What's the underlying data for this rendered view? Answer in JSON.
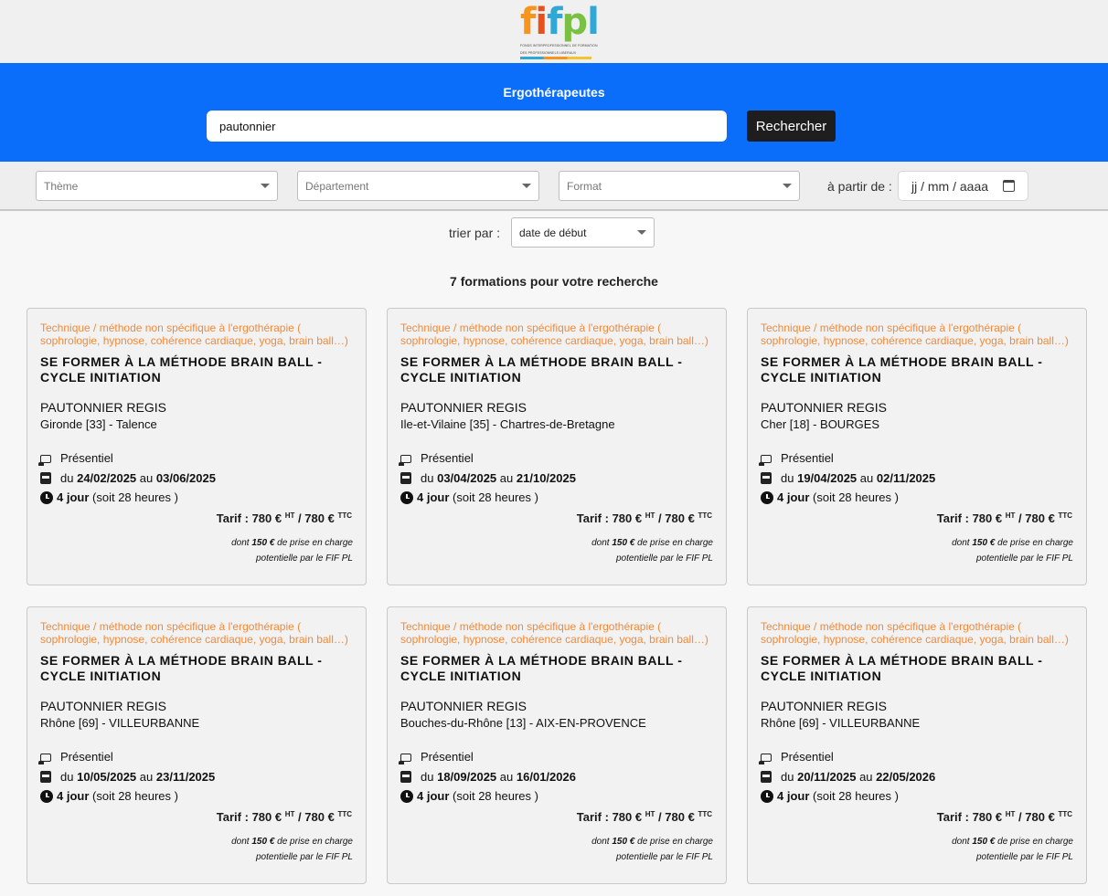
{
  "logo": {
    "name": "fifpl",
    "letters": [
      "f",
      "i",
      "f",
      "p",
      "l"
    ],
    "subtitle_line1": "FONDS INTERPROFESSIONNEL DE FORMATION",
    "subtitle_line2": "DES PROFESSIONNELS LIBERAUX"
  },
  "search": {
    "profession": "Ergothérapeutes",
    "query": "pautonnier",
    "button_label": "Rechercher"
  },
  "filters": {
    "theme_placeholder": "Thème",
    "department_placeholder": "Département",
    "format_placeholder": "Format",
    "date_label": "à partir de :",
    "date_placeholder": "jj / mm / aaaa"
  },
  "sort": {
    "label": "trier par :",
    "selected": "date de début"
  },
  "results": {
    "count_text": "7 formations pour votre recherche"
  },
  "card_labels": {
    "du": "du",
    "au": "au",
    "tarif_prefix": "Tarif :",
    "ht": "HT",
    "ttc": "TTC",
    "note_prefix": "dont",
    "note_suffix": "de prise en charge",
    "note_line2": "potentielle par le FIF PL"
  },
  "cards": [
    {
      "theme": "Technique / méthode non spécifique à l'ergothérapie ( sophrologie, hypnose, cohérence cardiaque, yoga, brain ball…)",
      "title": "SE FORMER À LA MÉTHODE BRAIN BALL - CYCLE INITIATION",
      "organizer": "PAUTONNIER REGIS",
      "location": "Gironde [33] - Talence",
      "format": "Présentiel",
      "date_start": "24/02/2025",
      "date_end": "03/06/2025",
      "duration_bold": "4 jour",
      "duration_rest": "(soit 28 heures )",
      "price_ht": "780 €",
      "price_ttc": "780 €",
      "support_amount": "150 €"
    },
    {
      "theme": "Technique / méthode non spécifique à l'ergothérapie ( sophrologie, hypnose, cohérence cardiaque, yoga, brain ball…)",
      "title": "SE FORMER À LA MÉTHODE BRAIN BALL - CYCLE INITIATION",
      "organizer": "PAUTONNIER REGIS",
      "location": "Ile-et-Vilaine [35] - Chartres-de-Bretagne",
      "format": "Présentiel",
      "date_start": "03/04/2025",
      "date_end": "21/10/2025",
      "duration_bold": "4 jour",
      "duration_rest": "(soit 28 heures )",
      "price_ht": "780 €",
      "price_ttc": "780 €",
      "support_amount": "150 €"
    },
    {
      "theme": "Technique / méthode non spécifique à l'ergothérapie ( sophrologie, hypnose, cohérence cardiaque, yoga, brain ball…)",
      "title": "SE FORMER À LA MÉTHODE BRAIN BALL - CYCLE INITIATION",
      "organizer": "PAUTONNIER REGIS",
      "location": "Cher [18] - BOURGES",
      "format": "Présentiel",
      "date_start": "19/04/2025",
      "date_end": "02/11/2025",
      "duration_bold": "4 jour",
      "duration_rest": "(soit 28 heures )",
      "price_ht": "780 €",
      "price_ttc": "780 €",
      "support_amount": "150 €"
    },
    {
      "theme": "Technique / méthode non spécifique à l'ergothérapie ( sophrologie, hypnose, cohérence cardiaque, yoga, brain ball…)",
      "title": "SE FORMER À LA MÉTHODE BRAIN BALL - CYCLE INITIATION",
      "organizer": "PAUTONNIER REGIS",
      "location": "Rhône [69] - VILLEURBANNE",
      "format": "Présentiel",
      "date_start": "10/05/2025",
      "date_end": "23/11/2025",
      "duration_bold": "4 jour",
      "duration_rest": "(soit 28 heures )",
      "price_ht": "780 €",
      "price_ttc": "780 €",
      "support_amount": "150 €"
    },
    {
      "theme": "Technique / méthode non spécifique à l'ergothérapie ( sophrologie, hypnose, cohérence cardiaque, yoga, brain ball…)",
      "title": "SE FORMER À LA MÉTHODE BRAIN BALL - CYCLE INITIATION",
      "organizer": "PAUTONNIER REGIS",
      "location": "Bouches-du-Rhône [13] - AIX-EN-PROVENCE",
      "format": "Présentiel",
      "date_start": "18/09/2025",
      "date_end": "16/01/2026",
      "duration_bold": "4 jour",
      "duration_rest": "(soit 28 heures )",
      "price_ht": "780 €",
      "price_ttc": "780 €",
      "support_amount": "150 €"
    },
    {
      "theme": "Technique / méthode non spécifique à l'ergothérapie ( sophrologie, hypnose, cohérence cardiaque, yoga, brain ball…)",
      "title": "SE FORMER À LA MÉTHODE BRAIN BALL - CYCLE INITIATION",
      "organizer": "PAUTONNIER REGIS",
      "location": "Rhône [69] - VILLEURBANNE",
      "format": "Présentiel",
      "date_start": "20/11/2025",
      "date_end": "22/05/2026",
      "duration_bold": "4 jour",
      "duration_rest": "(soit 28 heures )",
      "price_ht": "780 €",
      "price_ttc": "780 €",
      "support_amount": "150 €"
    }
  ],
  "colors": {
    "search_band": "#0a6efa",
    "theme_text": "#f08a3c",
    "button_dark": "#1e1e1e"
  },
  "icons": {
    "format": "presentiel-icon",
    "dates": "calendar-icon",
    "duration": "clock-icon",
    "select_caret": "chevron-down-icon",
    "date_picker": "calendar-icon"
  }
}
